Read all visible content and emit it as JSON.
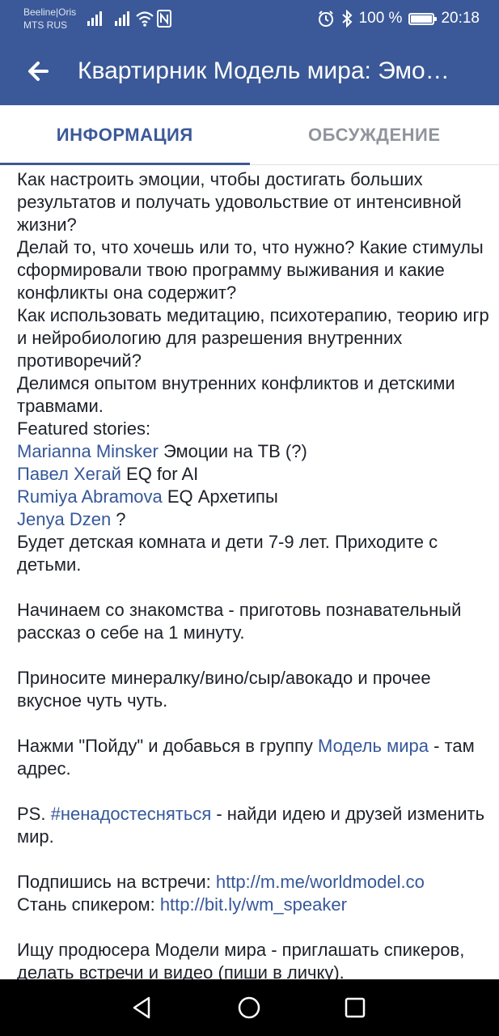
{
  "status_bar": {
    "carrier1": "Beeline|Oris",
    "carrier2": "MTS RUS",
    "battery": "100 %",
    "time": "20:18"
  },
  "app_bar": {
    "title": "Квартирник Модель мира: Эмоции"
  },
  "tabs": [
    {
      "label": "ИНФОРМАЦИЯ"
    },
    {
      "label": "ОБСУЖДЕНИЕ"
    }
  ],
  "content": {
    "intro": "Как настроить эмоции, чтобы достигать больших результатов и получать удовольствие от интенсивной жизни?\nДелай то, что хочешь или то, что нужно? Какие стимулы сформировали твою программу выживания и какие конфликты она содержит?\nКак использовать медитацию, психотерапию, теорию игр и нейробиологию для разрешения внутренних противоречий?\nДелимся опытом внутренних конфликтов и детскими травмами.\nFeatured stories:",
    "stories": [
      {
        "name": "Marianna Minsker",
        "topic": " Эмоции на ТВ (?)"
      },
      {
        "name": "Павел Хегай",
        "topic": " EQ for AI"
      },
      {
        "name": "Rumiya Abramova",
        "topic": " EQ Архетипы"
      },
      {
        "name": "Jenya Dzen",
        "topic": " ?"
      }
    ],
    "kids": "Будет детская комната и дети 7-9 лет. Приходите с детьми.",
    "intro_story": "Начинаем со знакомства - приготовь познавательный рассказ о себе на 1 минуту.",
    "bring": "Приносите минералку/вино/сыр/авокадо и прочее вкусное чуть чуть.",
    "join_before": "Нажми \"Пойду\" и добавься в группу ",
    "join_link": "Модель мира",
    "join_after": " - там адрес.",
    "ps_before": "PS. ",
    "ps_hashtag": "#ненадостесняться",
    "ps_after": " - найди идею и друзей изменить мир.",
    "subscribe_label": "Подпишись на встречи: ",
    "subscribe_link": "http://m.me/worldmodel.co",
    "speaker_label": "Стань спикером: ",
    "speaker_link": "http://bit.ly/wm_speaker",
    "producer": "Ищу продюсера Модели мира - приглашать спикеров, делать встречи и видео (пиши в личку)."
  },
  "colors": {
    "brand": "#3b5998",
    "link": "#365899",
    "text": "#1d2129",
    "inactive_tab": "#90949c"
  },
  "icons": [
    "back-arrow-icon",
    "wifi-icon",
    "nfc-icon",
    "alarm-icon",
    "bluetooth-icon",
    "battery-icon",
    "nav-back-icon",
    "nav-home-icon",
    "nav-recents-icon"
  ]
}
